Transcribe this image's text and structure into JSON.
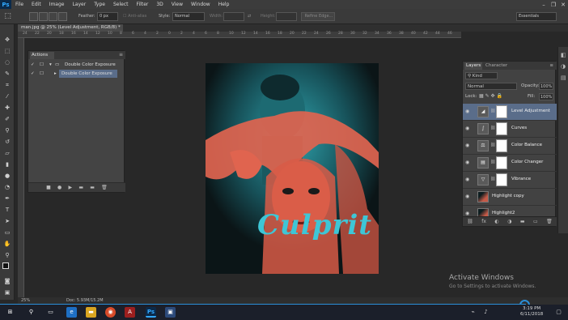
{
  "menubar": {
    "logo": "Ps",
    "items": [
      "File",
      "Edit",
      "Image",
      "Layer",
      "Type",
      "Select",
      "Filter",
      "3D",
      "View",
      "Window",
      "Help"
    ],
    "window_controls": [
      "–",
      "❐",
      "✕"
    ]
  },
  "options": {
    "feather_label": "Feather:",
    "feather_value": "0 px",
    "antialias_label": "Anti-alias",
    "style_label": "Style:",
    "style_value": "Normal",
    "width_label": "Width:",
    "height_label": "Height:",
    "refine_label": "Refine Edge...",
    "workspace_value": "Essentials"
  },
  "document": {
    "tab_label": "man.jpg @ 25% (Level Adjustment, RGB/8) *",
    "ruler_ticks": [
      "24",
      "22",
      "20",
      "18",
      "16",
      "14",
      "12",
      "10",
      "8",
      "6",
      "4",
      "2",
      "0",
      "2",
      "4",
      "6",
      "8",
      "10",
      "12",
      "14",
      "16",
      "18",
      "20",
      "22",
      "24",
      "26",
      "28",
      "30",
      "32",
      "34",
      "36",
      "38",
      "40",
      "42",
      "44",
      "46"
    ]
  },
  "actions": {
    "tab": "Actions",
    "rows": [
      {
        "label": "Double Color Exposure",
        "type": "set"
      },
      {
        "label": "Double Color Exposure",
        "type": "action"
      }
    ],
    "footer_icons": [
      "■",
      "●",
      "▶",
      "▬",
      "▬",
      "🗑"
    ]
  },
  "canvas": {
    "title_text": "Culprit"
  },
  "layers": {
    "tabs": [
      "Layers",
      "Character"
    ],
    "kind_label": "Kind",
    "blend_mode": "Normal",
    "opacity_label": "Opacity:",
    "opacity_value": "100%",
    "lock_label": "Lock:",
    "fill_label": "Fill:",
    "fill_value": "100%",
    "rows": [
      {
        "name": "Level Adjustment",
        "icon": "levels-icon",
        "glyph": "◢",
        "selected": true
      },
      {
        "name": "Curves",
        "icon": "curves-icon",
        "glyph": "∫",
        "selected": false
      },
      {
        "name": "Color Balance",
        "icon": "color-balance-icon",
        "glyph": "⚖",
        "selected": false
      },
      {
        "name": "Color Changer",
        "icon": "color-changer-icon",
        "glyph": "▤",
        "selected": false
      },
      {
        "name": "Vibrance",
        "icon": "vibrance-icon",
        "glyph": "▽",
        "selected": false
      },
      {
        "name": "Highlight copy",
        "icon": "image-thumb-icon",
        "glyph": "",
        "selected": false
      },
      {
        "name": "Highlight2",
        "icon": "image-thumb-icon",
        "glyph": "",
        "selected": false
      }
    ],
    "footer_icons": [
      "⛓",
      "fx",
      "◐",
      "◑",
      "▬",
      "▭",
      "🗑"
    ]
  },
  "status": {
    "zoom": "25%",
    "doc": "Doc: 5.93M/15.2M"
  },
  "watermark": {
    "title": "Activate Windows",
    "subtitle": "Go to Settings to activate Windows."
  },
  "taskbar": {
    "time": "3:19 PM",
    "date": "6/11/2018"
  },
  "colors": {
    "accent": "#31a8ff",
    "coral": "#e0644f",
    "teal": "#1f8a95",
    "selected_row": "#5a6d8a"
  }
}
